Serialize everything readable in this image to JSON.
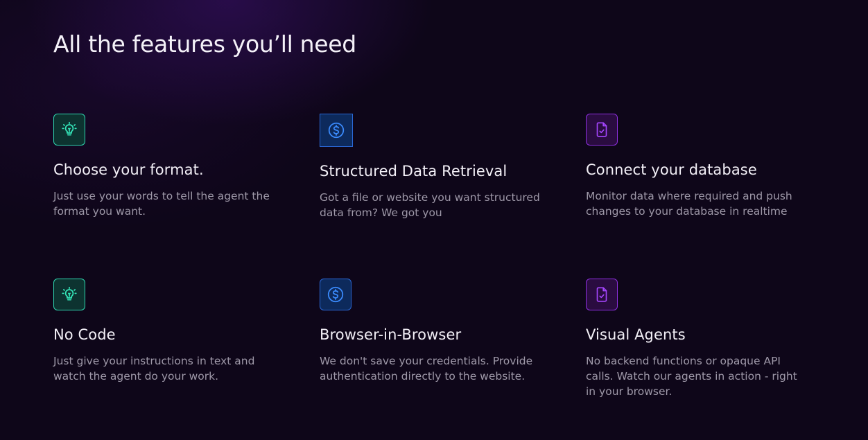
{
  "section": {
    "heading": "All the features you’ll need"
  },
  "features": [
    {
      "title": "Choose your format.",
      "description": "Just use your words to tell the agent the format you want.",
      "icon": "lightbulb-icon",
      "accent": "#34e3b7"
    },
    {
      "title": "Structured Data Retrieval",
      "description": "Got a file or website you want structured data from? We got you",
      "icon": "dollar-circle-icon",
      "accent": "#3b8cff"
    },
    {
      "title": "Connect your database",
      "description": "Monitor data where required and push changes to your database in realtime",
      "icon": "document-check-icon",
      "accent": "#a646ff"
    },
    {
      "title": "No Code",
      "description": "Just give your instructions in text and watch the agent do your work.",
      "icon": "lightbulb-icon",
      "accent": "#34e3b7"
    },
    {
      "title": "Browser-in-Browser",
      "description": "We don't save your credentials. Provide authentication directly to the website.",
      "icon": "dollar-circle-icon",
      "accent": "#3b8cff"
    },
    {
      "title": "Visual Agents",
      "description": "No backend functions or opaque API calls. Watch our agents in action - right in your browser.",
      "icon": "document-check-icon",
      "accent": "#a646ff"
    }
  ]
}
